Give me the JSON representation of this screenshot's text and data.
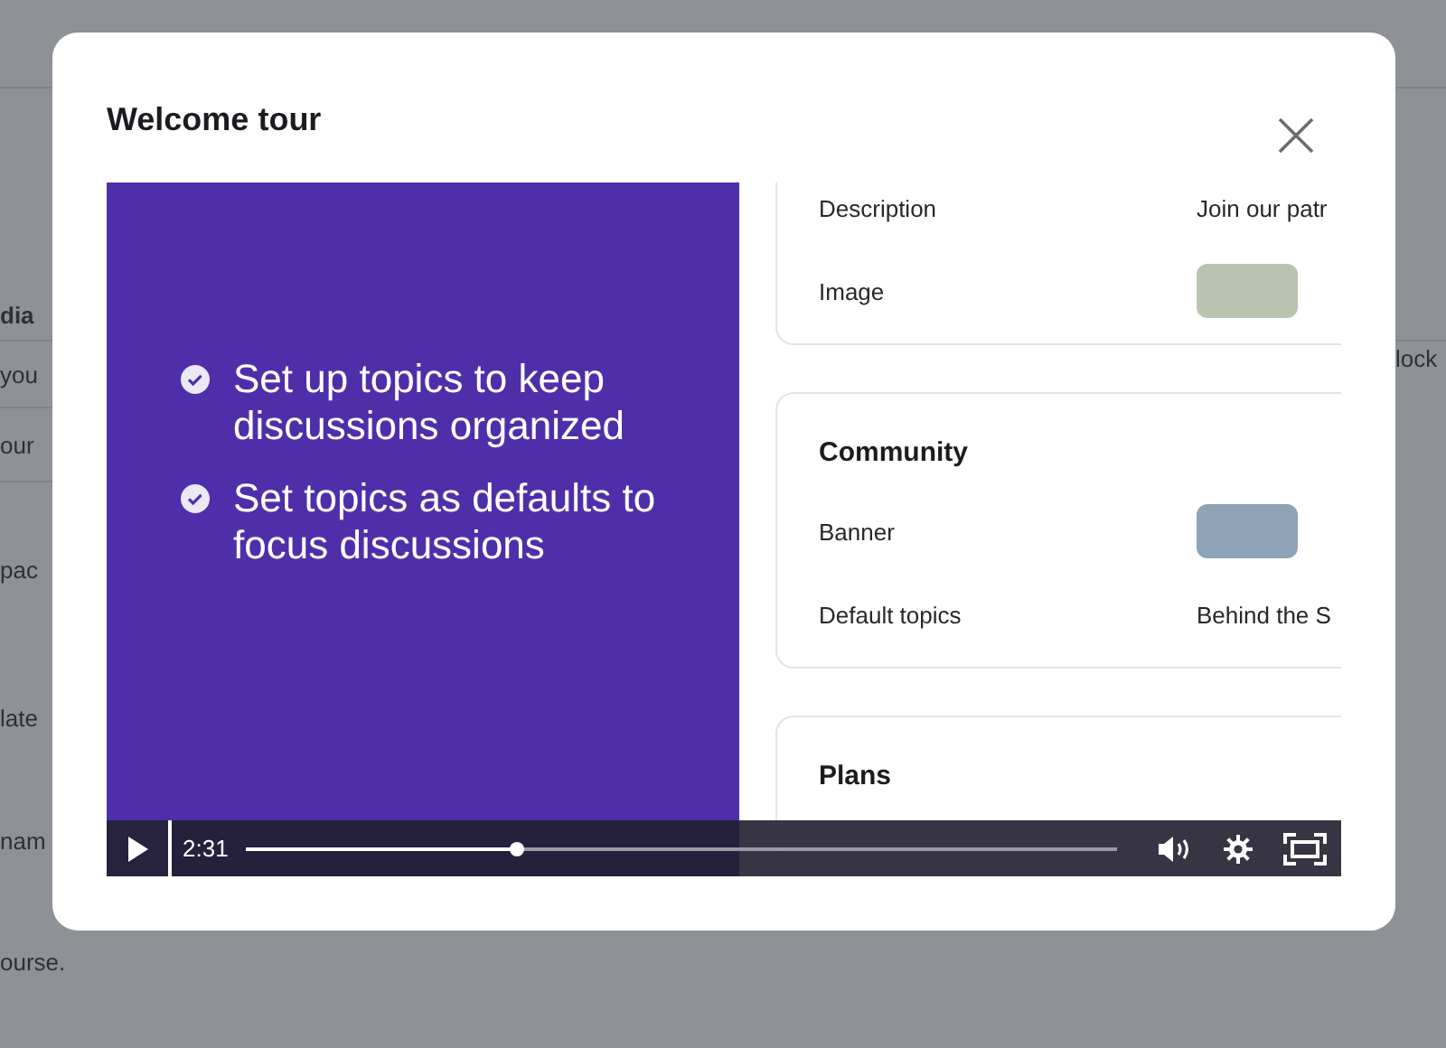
{
  "background": {
    "left_fragments": [
      {
        "text": "dia",
        "bold": true
      },
      {
        "text": "you",
        "bold": false
      },
      {
        "text": "our",
        "bold": false
      },
      {
        "text": "pac",
        "bold": false
      },
      {
        "text": "late",
        "bold": false
      },
      {
        "text": "nam",
        "bold": false
      },
      {
        "text": "ourse.",
        "bold": false
      }
    ],
    "right_fragments": [
      "lock"
    ]
  },
  "dialog": {
    "title": "Welcome tour"
  },
  "slide": {
    "bullets": [
      "Set up topics to keep discussions organized",
      "Set topics as defaults to focus discussions"
    ]
  },
  "preview": {
    "sections": [
      {
        "rows": [
          {
            "label": "Description",
            "kind": "text",
            "value": "Join our patr"
          },
          {
            "label": "Image",
            "kind": "image"
          }
        ]
      },
      {
        "title": "Community",
        "rows": [
          {
            "label": "Banner",
            "kind": "image"
          },
          {
            "label": "Default topics",
            "kind": "text",
            "value": "Behind the S"
          }
        ]
      },
      {
        "title": "Plans"
      }
    ]
  },
  "player": {
    "playing": false,
    "time": "2:31",
    "level": 0.31
  }
}
